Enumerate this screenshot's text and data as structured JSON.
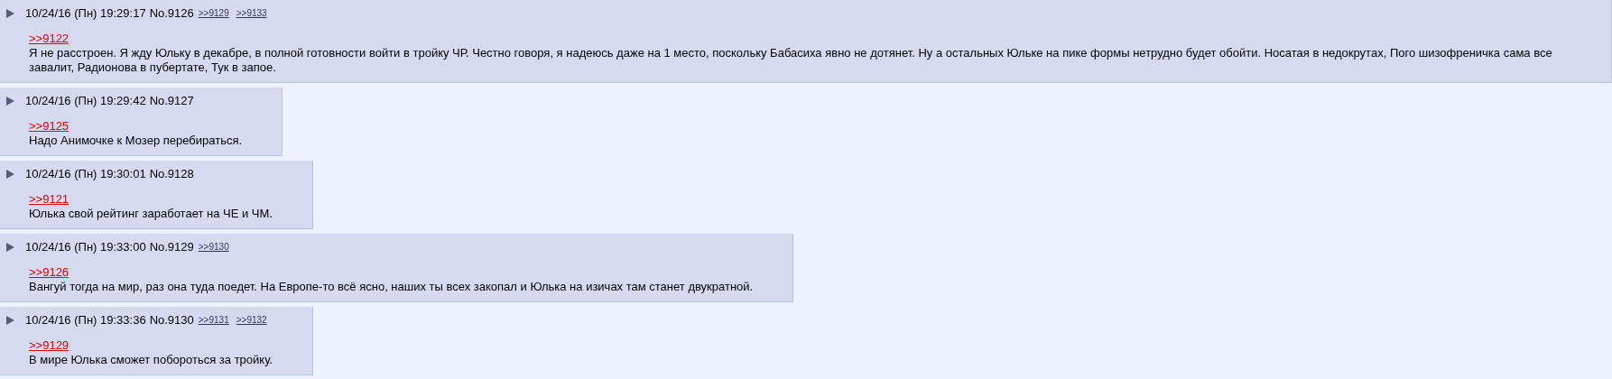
{
  "posts": [
    {
      "date": "10/24/16 (Пн) 19:29:17",
      "number": "No.9126",
      "replies": [
        ">>9129",
        ">>9133"
      ],
      "quote": ">>9122",
      "text": "Я не расстроен. Я жду Юльку в декабре, в полной готовности войти в тройку ЧР. Честно говоря, я надеюсь даже на 1 место, поскольку Бабасиха явно не дотянет. Ну а остальных Юльке на пике формы нетрудно будет обойти. Носатая в недокрутах, Пого шизофреничка сама все завалит, Радионова в пубертате, Тук в запое."
    },
    {
      "date": "10/24/16 (Пн) 19:29:42",
      "number": "No.9127",
      "quote": ">>9125",
      "text": "Надо Анимочке к Мозер перебираться."
    },
    {
      "date": "10/24/16 (Пн) 19:30:01",
      "number": "No.9128",
      "quote": ">>9121",
      "text": "Юлька свой рейтинг заработает на ЧЕ и ЧМ."
    },
    {
      "date": "10/24/16 (Пн) 19:33:00",
      "number": "No.9129",
      "replies": [
        ">>9130"
      ],
      "quote": ">>9126",
      "text": "Вангуй тогда на мир, раз она туда поедет. На Европе-то всё ясно, наших ты всех закопал и Юлька на изичах там станет двукратной."
    },
    {
      "date": "10/24/16 (Пн) 19:33:36",
      "number": "No.9130",
      "replies": [
        ">>9131",
        ">>9132"
      ],
      "quote": ">>9129",
      "text": "В мире Юлька сможет побороться за тройку."
    }
  ]
}
